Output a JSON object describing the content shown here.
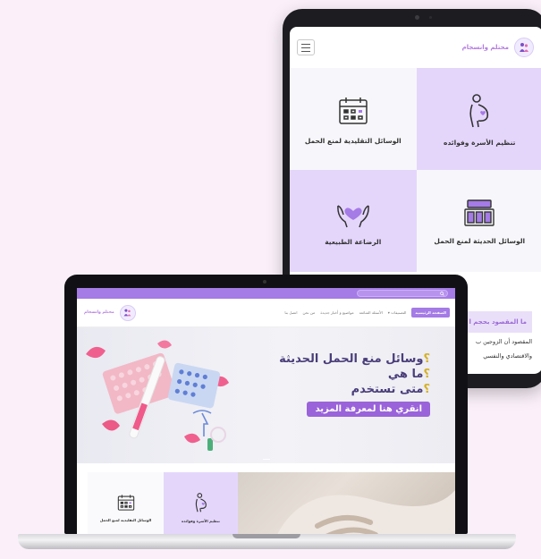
{
  "tablet": {
    "brand": "محتلم وانسجام",
    "cells": [
      {
        "label": "تنظيم الأسرة وفوائده",
        "icon": "pregnant-woman-icon"
      },
      {
        "label": "الوسائل التقليدية لمنع الحمل",
        "icon": "calendar-icon"
      },
      {
        "label": "الوسائل الحديثة لمنع الحمل",
        "icon": "pill-pack-icon"
      },
      {
        "label": "الرضاعة الطبيعية",
        "icon": "heart-hands-icon"
      }
    ],
    "banner": "ما المقصود بحجم ا",
    "para1": "المقصود أن الزوجين ب",
    "para2": "والاقتصادي والنفسي"
  },
  "laptop": {
    "brand": "محتلم وانسجام",
    "nav": [
      "الصفحة الرئيسية",
      "التصنيفات",
      "الأسئلة الشائعة",
      "مواضيع و أخبار جديدة",
      "من نحن",
      "اتصل بنا"
    ],
    "hero": {
      "line1": "وسائل منع الحمل الحديثة",
      "line2": "ما هي",
      "line3": "متى تستخدم",
      "q": "؟",
      "cta": "انقري هنا لمعرفة المزيد"
    },
    "cells": [
      {
        "label": "تنظيم الأسرة وفوائده"
      },
      {
        "label": "الوسائل التقليدية لمنع الحمل"
      }
    ]
  },
  "colors": {
    "accent": "#a57be6",
    "soft": "#e4d6fb",
    "question": "#d6b026"
  }
}
